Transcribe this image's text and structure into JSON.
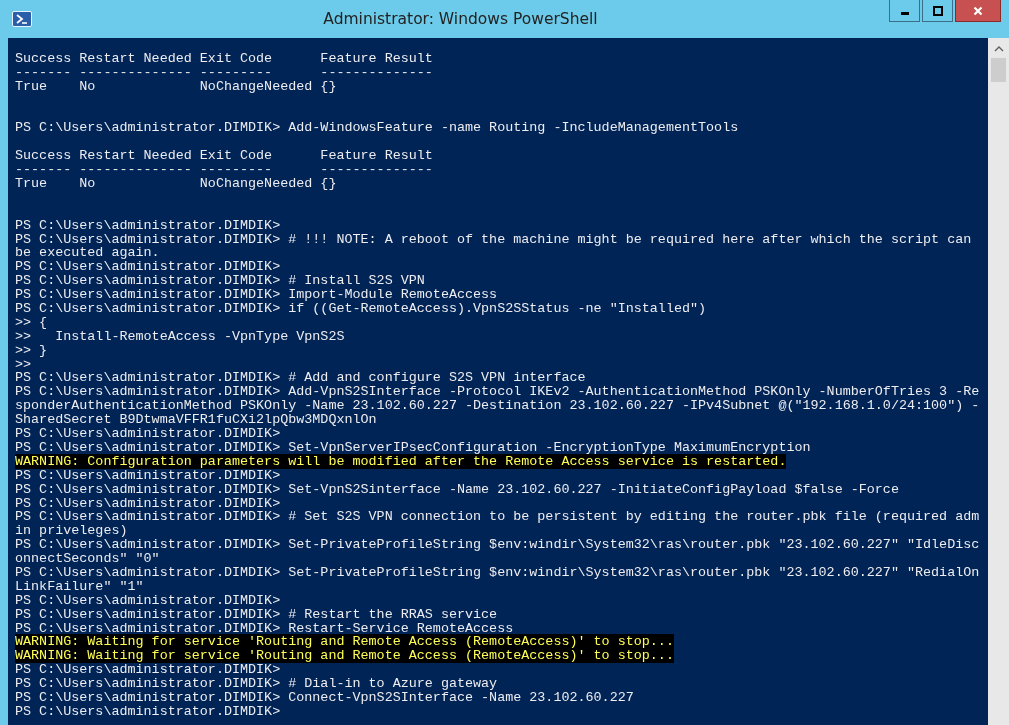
{
  "window": {
    "title": "Administrator: Windows PowerShell"
  },
  "console": {
    "lines": [
      {
        "kind": "output",
        "text": "Success Restart Needed Exit Code      Feature Result"
      },
      {
        "kind": "output",
        "text": "------- -------------- ---------      --------------"
      },
      {
        "kind": "output",
        "text": "True    No             NoChangeNeeded {}"
      },
      {
        "kind": "blank"
      },
      {
        "kind": "blank"
      },
      {
        "kind": "output",
        "text": "PS C:\\Users\\administrator.DIMDIK> Add-WindowsFeature -name Routing -IncludeManagementTools"
      },
      {
        "kind": "blank"
      },
      {
        "kind": "output",
        "text": "Success Restart Needed Exit Code      Feature Result"
      },
      {
        "kind": "output",
        "text": "------- -------------- ---------      --------------"
      },
      {
        "kind": "output",
        "text": "True    No             NoChangeNeeded {}"
      },
      {
        "kind": "blank"
      },
      {
        "kind": "blank"
      },
      {
        "kind": "output",
        "text": "PS C:\\Users\\administrator.DIMDIK>"
      },
      {
        "kind": "output",
        "text": "PS C:\\Users\\administrator.DIMDIK> # !!! NOTE: A reboot of the machine might be required here after which the script can"
      },
      {
        "kind": "output",
        "text": "be executed again."
      },
      {
        "kind": "output",
        "text": "PS C:\\Users\\administrator.DIMDIK>"
      },
      {
        "kind": "output",
        "text": "PS C:\\Users\\administrator.DIMDIK> # Install S2S VPN"
      },
      {
        "kind": "output",
        "text": "PS C:\\Users\\administrator.DIMDIK> Import-Module RemoteAccess"
      },
      {
        "kind": "output",
        "text": "PS C:\\Users\\administrator.DIMDIK> if ((Get-RemoteAccess).VpnS2SStatus -ne \"Installed\")"
      },
      {
        "kind": "output",
        "text": ">> {"
      },
      {
        "kind": "output",
        "text": ">>   Install-RemoteAccess -VpnType VpnS2S"
      },
      {
        "kind": "output",
        "text": ">> }"
      },
      {
        "kind": "output",
        "text": ">>"
      },
      {
        "kind": "output",
        "text": "PS C:\\Users\\administrator.DIMDIK> # Add and configure S2S VPN interface"
      },
      {
        "kind": "output",
        "text": "PS C:\\Users\\administrator.DIMDIK> Add-VpnS2SInterface -Protocol IKEv2 -AuthenticationMethod PSKOnly -NumberOfTries 3 -Re"
      },
      {
        "kind": "output",
        "text": "sponderAuthenticationMethod PSKOnly -Name 23.102.60.227 -Destination 23.102.60.227 -IPv4Subnet @(\"192.168.1.0/24:100\") -"
      },
      {
        "kind": "output",
        "text": "SharedSecret B9DtwmaVFFR1fuCXi2lpQbw3MDQxnlOn"
      },
      {
        "kind": "output",
        "text": "PS C:\\Users\\administrator.DIMDIK>"
      },
      {
        "kind": "output",
        "text": "PS C:\\Users\\administrator.DIMDIK> Set-VpnServerIPsecConfiguration -EncryptionType MaximumEncryption"
      },
      {
        "kind": "warning",
        "text": "WARNING: Configuration parameters will be modified after the Remote Access service is restarted."
      },
      {
        "kind": "output",
        "text": "PS C:\\Users\\administrator.DIMDIK>"
      },
      {
        "kind": "output",
        "text": "PS C:\\Users\\administrator.DIMDIK> Set-VpnS2Sinterface -Name 23.102.60.227 -InitiateConfigPayload $false -Force"
      },
      {
        "kind": "output",
        "text": "PS C:\\Users\\administrator.DIMDIK>"
      },
      {
        "kind": "output",
        "text": "PS C:\\Users\\administrator.DIMDIK> # Set S2S VPN connection to be persistent by editing the router.pbk file (required adm"
      },
      {
        "kind": "output",
        "text": "in priveleges)"
      },
      {
        "kind": "output",
        "text": "PS C:\\Users\\administrator.DIMDIK> Set-PrivateProfileString $env:windir\\System32\\ras\\router.pbk \"23.102.60.227\" \"IdleDisc"
      },
      {
        "kind": "output",
        "text": "onnectSeconds\" \"0\""
      },
      {
        "kind": "output",
        "text": "PS C:\\Users\\administrator.DIMDIK> Set-PrivateProfileString $env:windir\\System32\\ras\\router.pbk \"23.102.60.227\" \"RedialOn"
      },
      {
        "kind": "output",
        "text": "LinkFailure\" \"1\""
      },
      {
        "kind": "output",
        "text": "PS C:\\Users\\administrator.DIMDIK>"
      },
      {
        "kind": "output",
        "text": "PS C:\\Users\\administrator.DIMDIK> # Restart the RRAS service"
      },
      {
        "kind": "output",
        "text": "PS C:\\Users\\administrator.DIMDIK> Restart-Service RemoteAccess"
      },
      {
        "kind": "warning",
        "text": "WARNING: Waiting for service 'Routing and Remote Access (RemoteAccess)' to stop..."
      },
      {
        "kind": "warning",
        "text": "WARNING: Waiting for service 'Routing and Remote Access (RemoteAccess)' to stop..."
      },
      {
        "kind": "output",
        "text": "PS C:\\Users\\administrator.DIMDIK>"
      },
      {
        "kind": "output",
        "text": "PS C:\\Users\\administrator.DIMDIK> # Dial-in to Azure gateway"
      },
      {
        "kind": "output",
        "text": "PS C:\\Users\\administrator.DIMDIK> Connect-VpnS2SInterface -Name 23.102.60.227"
      },
      {
        "kind": "output",
        "text": "PS C:\\Users\\administrator.DIMDIK>"
      }
    ]
  }
}
